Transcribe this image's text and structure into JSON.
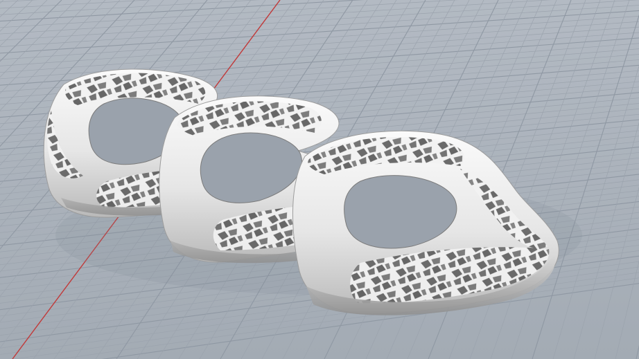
{
  "viewport": {
    "projection": "perspective",
    "background_color": "#a8b0b9",
    "grid_minor_color": "#9ba3ad",
    "grid_major_color": "#8f98a3",
    "x_axis_color": "#c23a3a",
    "model_color": "#e8e8e8",
    "model_shadow_color": "#8a8a8a"
  },
  "model": {
    "object": "chain",
    "link_count": 3,
    "pattern": "voronoi-lattice"
  },
  "icons": {
    "axis": "x-axis-line",
    "grid": "construction-grid"
  }
}
